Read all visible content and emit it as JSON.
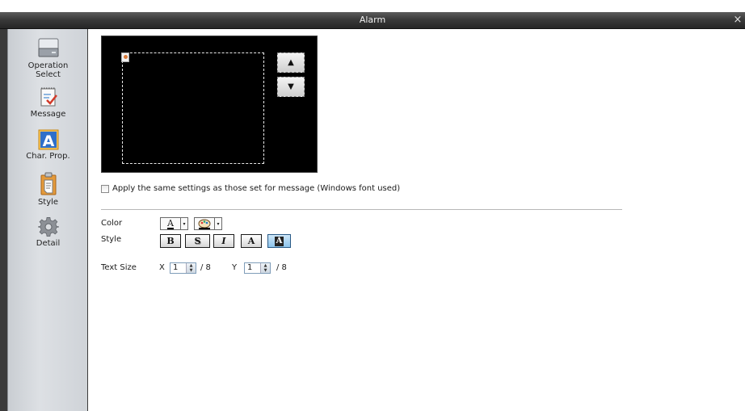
{
  "window": {
    "title": "Alarm",
    "close_glyph": "×"
  },
  "sidebar": {
    "items": [
      {
        "label_line1": "Operation",
        "label_line2": "Select",
        "icon": "drive-icon"
      },
      {
        "label_line1": "Message",
        "label_line2": "",
        "icon": "notepad-check-icon"
      },
      {
        "label_line1": "Char. Prop.",
        "label_line2": "",
        "icon": "letter-a-icon",
        "selected": true
      },
      {
        "label_line1": "Style",
        "label_line2": "",
        "icon": "clipboard-icon"
      },
      {
        "label_line1": "Detail",
        "label_line2": "",
        "icon": "gear-icon"
      }
    ]
  },
  "preview": {
    "up_glyph": "▲",
    "down_glyph": "▼"
  },
  "apply_same_settings": {
    "label": "Apply the same settings as those set for message (Windows font used)",
    "checked": false
  },
  "color": {
    "label": "Color",
    "text_glyph": "A",
    "arrow": "▾"
  },
  "style": {
    "label": "Style",
    "buttons": [
      {
        "glyph": "B",
        "name": "bold"
      },
      {
        "glyph": "S",
        "name": "shadow"
      },
      {
        "glyph": "I",
        "name": "italic"
      },
      {
        "glyph": "A",
        "name": "normal-text"
      },
      {
        "glyph": "A",
        "name": "highlighted-text",
        "active": true
      }
    ]
  },
  "text_size": {
    "label": "Text Size",
    "x_label": "X",
    "x_value": "1",
    "x_max": "/ 8",
    "y_label": "Y",
    "y_value": "1",
    "y_max": "/ 8"
  },
  "colors": {
    "titlebar": "#333333",
    "preview_bg": "#000000",
    "accent": "#2a6cb0"
  }
}
